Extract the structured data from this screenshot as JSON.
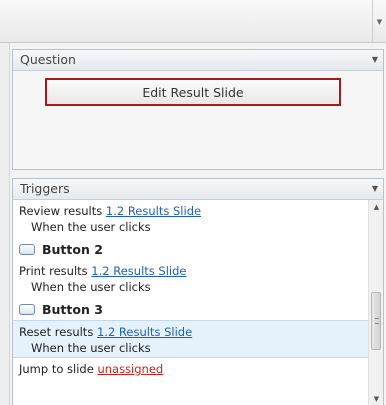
{
  "question_panel": {
    "title": "Question",
    "edit_button_label": "Edit Result Slide"
  },
  "triggers_panel": {
    "title": "Triggers",
    "items": [
      {
        "action": "Review results",
        "target": "1.2 Results Slide",
        "condition": "When the user clicks"
      },
      {
        "object": "Button 2"
      },
      {
        "action": "Print results",
        "target": "1.2 Results Slide",
        "condition": "When the user clicks"
      },
      {
        "object": "Button 3"
      },
      {
        "action": "Reset results",
        "target": "1.2 Results Slide",
        "condition": "When the user clicks"
      },
      {
        "action": "Jump to slide",
        "target": "unassigned"
      }
    ]
  },
  "colors": {
    "link": "#1f5fbf",
    "unassigned": "#d0231f",
    "highlight_border": "#a31b1b",
    "selected_row": "#e5f2fb"
  },
  "icons": {
    "dropdown": "chevron-down-icon",
    "scroll_up": "chevron-up-icon",
    "scroll_down": "chevron-down-icon",
    "button_object": "button-shape-icon"
  }
}
